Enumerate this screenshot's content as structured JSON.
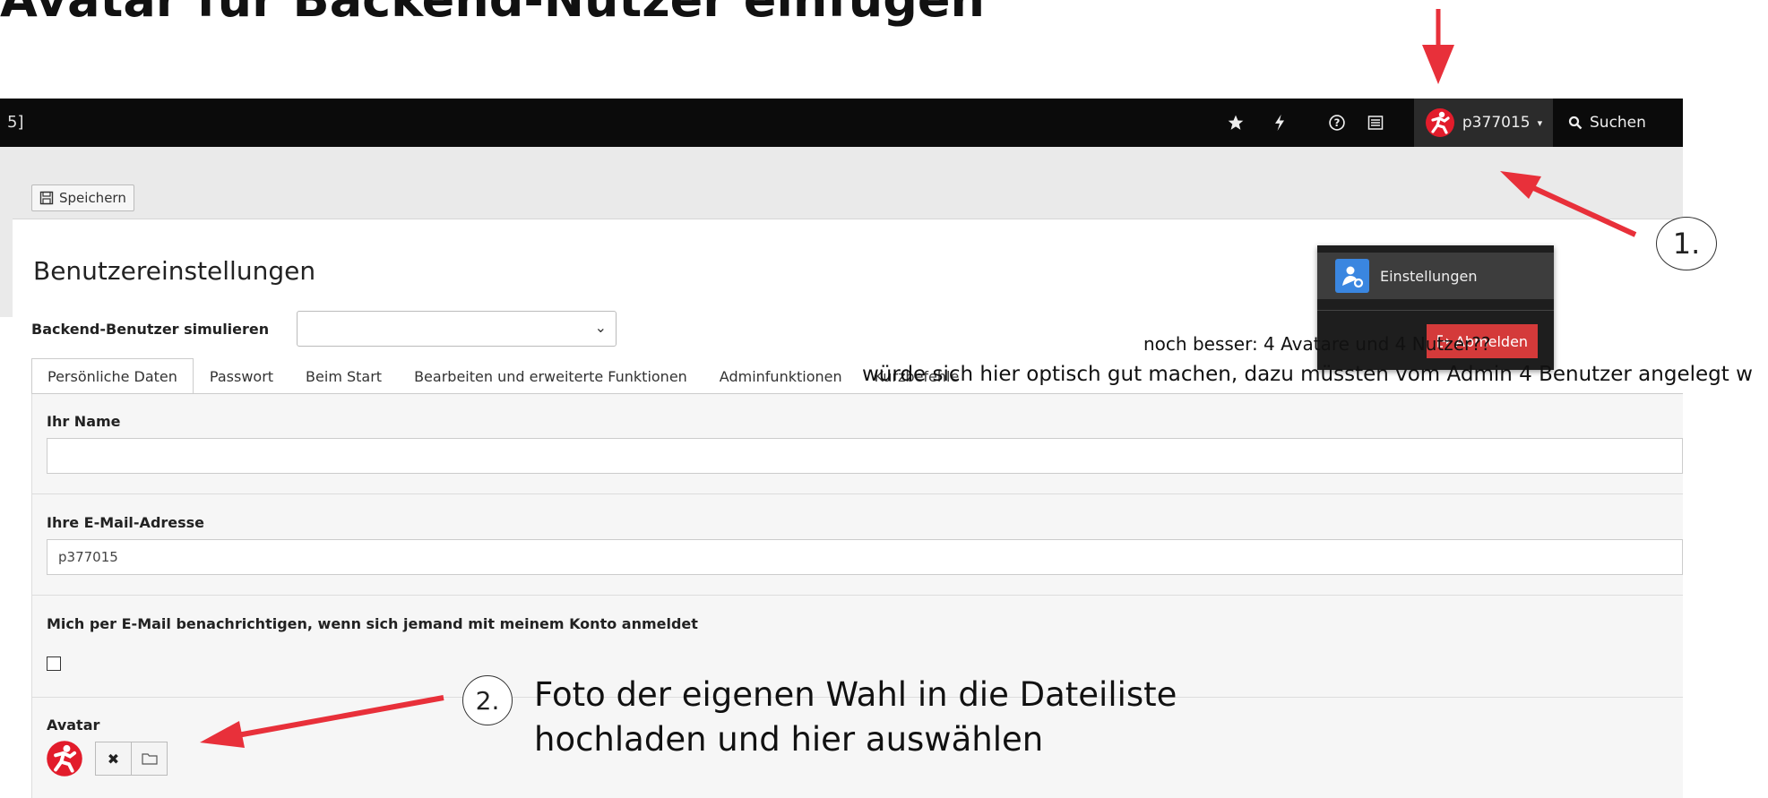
{
  "slide": {
    "title": "Avatar für Backend-Nutzer einfügen",
    "annotation_1": "1.",
    "annotation_2": "2.",
    "note_line1": "noch besser: 4 Avatare und 4 Nutzer??",
    "note_line2": "würde sich hier optisch gut machen, dazu müssten vom Admin 4 Benutzer angelegt w",
    "instruction_line1": "Foto der eigenen Wahl in die Dateiliste",
    "instruction_line2": "hochladen und hier auswählen",
    "arrow_color": "#e8303a"
  },
  "topbar": {
    "left_text": "5]",
    "icons": [
      "star-icon",
      "bolt-icon",
      "help-icon",
      "list-icon"
    ],
    "username": "p377015",
    "search_label": "Suchen"
  },
  "usermenu": {
    "settings_label": "Einstellungen",
    "logout_label": "Abmelden"
  },
  "docheader": {
    "save_label": "Speichern"
  },
  "main": {
    "title": "Benutzereinstellungen",
    "simulate_label": "Backend-Benutzer simulieren",
    "simulate_value": "",
    "tabs": [
      {
        "label": "Persönliche Daten",
        "active": true
      },
      {
        "label": "Passwort",
        "active": false
      },
      {
        "label": "Beim Start",
        "active": false
      },
      {
        "label": "Bearbeiten und erweiterte Funktionen",
        "active": false
      },
      {
        "label": "Adminfunktionen",
        "active": false
      },
      {
        "label": "Kurzbefehle",
        "active": false
      }
    ],
    "fields": {
      "name_label": "Ihr Name",
      "name_value": "",
      "email_label": "Ihre E-Mail-Adresse",
      "email_value": "p377015",
      "notify_label": "Mich per E-Mail benachrichtigen, wenn sich jemand mit meinem Konto anmeldet",
      "notify_checked": false,
      "avatar_label": "Avatar"
    }
  }
}
